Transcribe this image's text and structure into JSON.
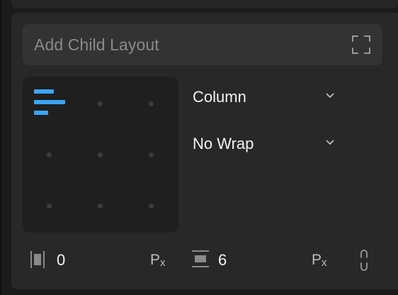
{
  "layout_panel": {
    "add_child_label": "Add Child Layout",
    "expand_icon": "expand-corners-icon",
    "alignment": {
      "active_icon": "align-left-bars-icon",
      "accent_color": "#3aa6f5"
    },
    "direction": {
      "value": "Column"
    },
    "wrap": {
      "value": "No Wrap"
    },
    "padding": {
      "icon": "padding-icon",
      "value": "0",
      "unit_main": "P",
      "unit_sub": "x"
    },
    "gap": {
      "icon": "gap-icon",
      "value": "6",
      "unit_main": "P",
      "unit_sub": "x"
    },
    "link_icon": "link-icon"
  }
}
